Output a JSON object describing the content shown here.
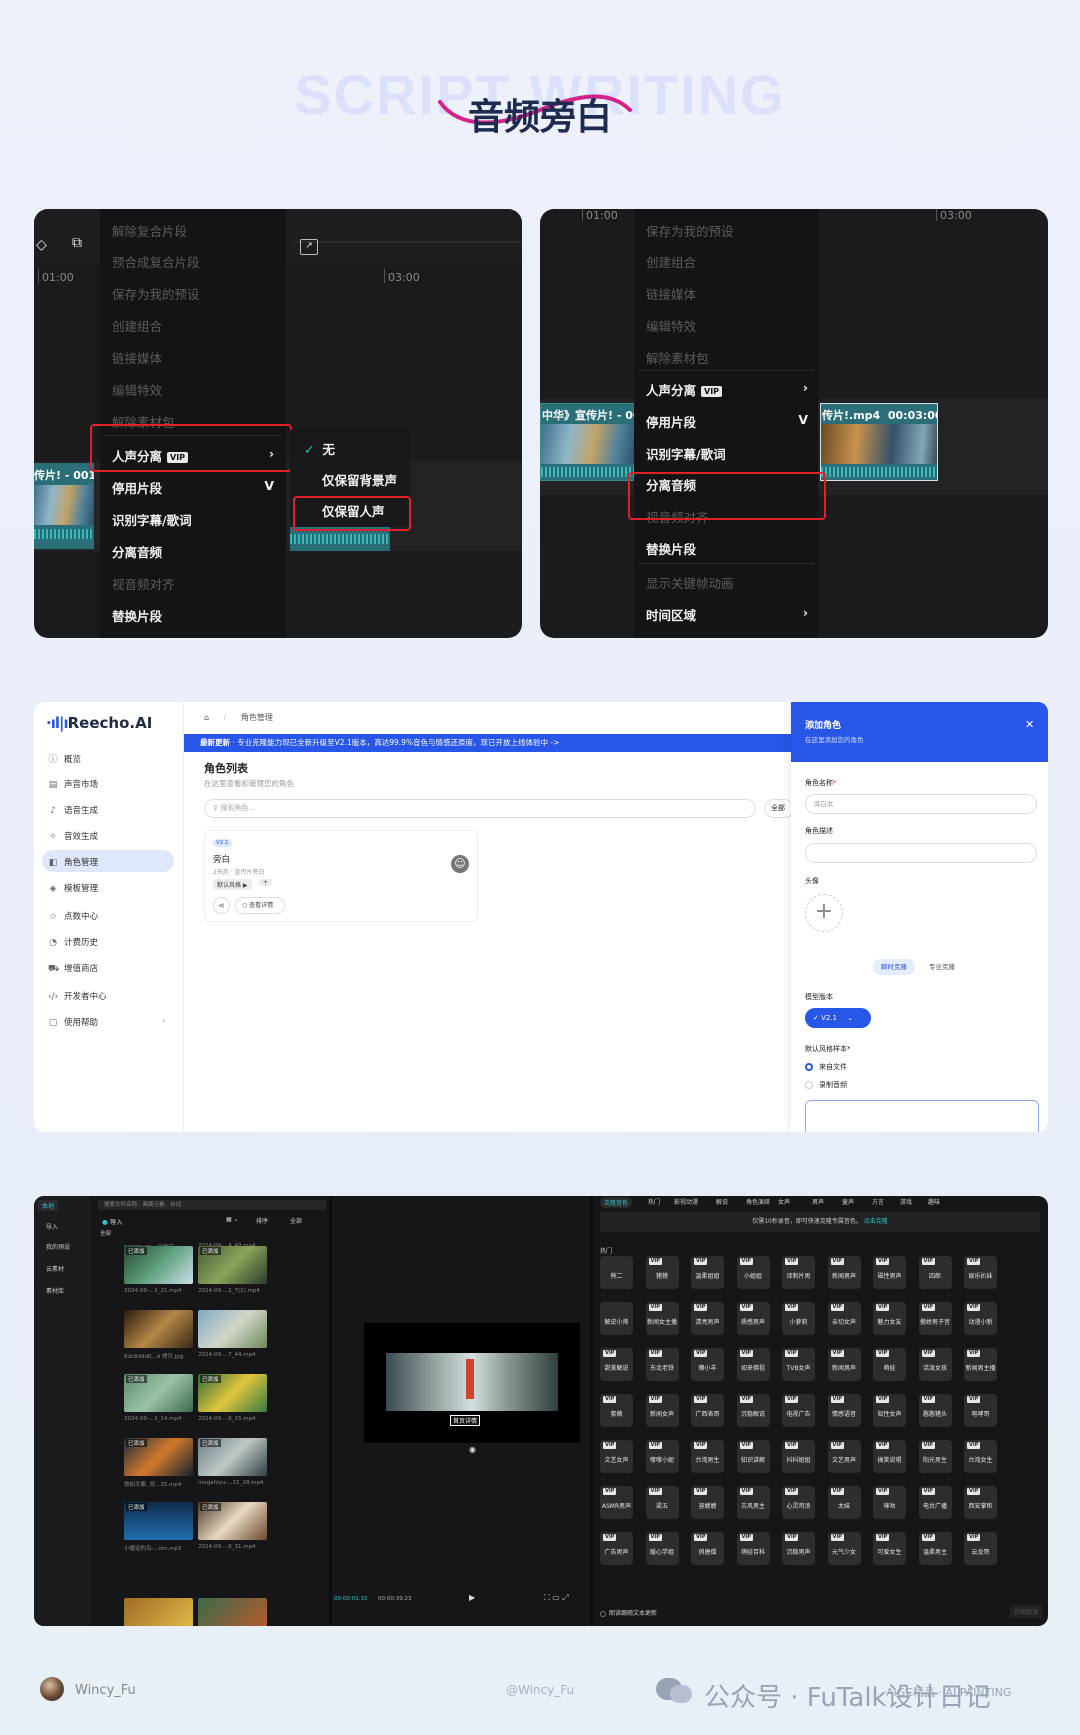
{
  "header": {
    "bg_word": "SCRIPT WRITING",
    "title": "音频旁白"
  },
  "panel1": {
    "timecode_left": "01:00",
    "timecode_right": "03:00",
    "context_menu": [
      {
        "label": "解除复合片段",
        "disabled": true
      },
      {
        "label": "预合成复合片段",
        "disabled": true
      },
      {
        "label": "保存为我的预设",
        "disabled": true
      },
      {
        "label": "创建组合",
        "disabled": true
      },
      {
        "label": "链接媒体",
        "disabled": true
      },
      {
        "label": "编辑特效",
        "disabled": true
      },
      {
        "label": "解除素材包",
        "disabled": true
      },
      {
        "label": "人声分离",
        "vip": "VIP",
        "arrow": "›"
      },
      {
        "label": "停用片段",
        "arrow": "V"
      },
      {
        "label": "识别字幕/歌词"
      },
      {
        "label": "分离音频"
      },
      {
        "label": "视音频对齐",
        "disabled": true
      },
      {
        "label": "替换片段"
      }
    ],
    "submenu": [
      {
        "label": "无",
        "check": "✓"
      },
      {
        "label": "仅保留背景声"
      },
      {
        "label": "仅保留人声"
      }
    ],
    "clip_label": "传片! - 001"
  },
  "panel2": {
    "timecode_left": "01:00",
    "timecode_right": "03:00",
    "context_menu": [
      {
        "label": "保存为我的预设",
        "disabled": true
      },
      {
        "label": "创建组合",
        "disabled": true
      },
      {
        "label": "链接媒体",
        "disabled": true
      },
      {
        "label": "编辑特效",
        "disabled": true
      },
      {
        "label": "解除素材包",
        "disabled": true
      },
      {
        "label": "人声分离",
        "vip": "VIP",
        "arrow": "›"
      },
      {
        "label": "停用片段",
        "arrow": "V"
      },
      {
        "label": "识别字幕/歌词"
      },
      {
        "label": "分离音频"
      },
      {
        "label": "视音频对齐",
        "disabled": true
      },
      {
        "label": "替换片段"
      },
      {
        "label": "显示关键帧动画",
        "disabled": true
      },
      {
        "label": "时间区域",
        "arrow": "›"
      }
    ],
    "clip_left_label": "中华》宣传片! - 00",
    "clip_right_label": "传片!.mp4",
    "clip_right_time": "00:03:00:0"
  },
  "web": {
    "logo": "Reecho.AI",
    "sidebar": [
      "概览",
      "声音市场",
      "语音生成",
      "音效生成",
      "角色管理",
      "模板管理",
      "点数中心",
      "计费历史",
      "增值商店",
      "开发者中心",
      "使用帮助"
    ],
    "sidebar_active": 4,
    "breadcrumb_sep": "/",
    "breadcrumb": "角色管理",
    "banner_strong": "最新更新",
    "banner_text": " · 专业克隆能力现已全新升级至V2.1版本，高达99.9%音色与情感还原度，现已开放上线体验中 ->",
    "list_title": "角色列表",
    "list_subtitle": "在这里查看和管理您的角色",
    "search_placeholder": "搜索角色...",
    "filter_all": "全部",
    "card": {
      "badge": "V2.1",
      "name": "旁白",
      "meta": "2天前 · 宣传片旁白",
      "chip": "默认风格 ▶",
      "chip2": "+",
      "detail": "查看详情"
    },
    "drawer": {
      "title": "添加角色",
      "subtitle": "在这里添加您的角色",
      "close": "✕",
      "name_label": "角色名称",
      "required": "*",
      "name_value": "旁白女",
      "desc_label": "角色描述",
      "avatar_label": "头像",
      "tab_instant": "瞬时克隆",
      "tab_pro": "专业克隆",
      "model_label": "模型版本",
      "model_value": "V2.1",
      "style_label": "默认风格样本",
      "option_file": "来自文件",
      "option_record": "录制音频"
    }
  },
  "bottom": {
    "left_nav": [
      "本地",
      "导入",
      "我的预设",
      "云素材",
      "素材库"
    ],
    "search_placeholder": "搜索文件名称、画面元素、台词",
    "import_label": "导入",
    "toolbar": [
      "排序",
      "全部"
    ],
    "group_label": "全部",
    "media": [
      {
        "tag": "",
        "cap": "92332e71...开眼床.jpeg"
      },
      {
        "tag": "",
        "cap": "2024-09-...4_49.mp4"
      },
      {
        "tag": "已添加",
        "cap": "2024-09-...1_21.mp4"
      },
      {
        "tag": "已添加",
        "cap": "2024-09-...2_7(1).mp4"
      },
      {
        "tag": "",
        "cap": "8dc8ddd0...d 拷贝.jpg"
      },
      {
        "tag": "",
        "cap": "2024-09-...7_44.mp4"
      },
      {
        "tag": "已添加",
        "cap": "2024-09-...1_14.mp4"
      },
      {
        "tag": "已添加",
        "cap": "2024-09-...6_15.mp4"
      },
      {
        "tag": "已添加",
        "cap": "旅拍文案, 领...35.mp4"
      },
      {
        "tag": "已添加",
        "cap": "megahiyu-...15_28.mp4"
      },
      {
        "tag": "已添加",
        "cap": "小媛运的鸟-...om.mp3"
      },
      {
        "tag": "已添加",
        "cap": "2024-09-...6_31.mp4"
      }
    ],
    "player_time": "00:00:01:15",
    "player_total": "00:00:39:23",
    "subtitle_text": "首页详情",
    "voice_tabs": [
      "克隆音色",
      "热门",
      "影视动漫",
      "解说",
      "角色演绎",
      "女声",
      "男声",
      "童声",
      "方言",
      "游戏",
      "趣味"
    ],
    "voice_notice": "仅需10秒录音，即可快速克隆专属音色。",
    "voice_notice_link": "点击克隆",
    "hot_label": "热门",
    "voices": [
      "熊二",
      "猪猪",
      "温柔姐姐",
      "小姐姐",
      "译制片男",
      "新闻男声",
      "磁性男声",
      "四郎",
      "娱乐扒妹",
      "解说小帅",
      "新闻女主播",
      "清亮男声",
      "质感男声",
      "小萝莉",
      "亲切女声",
      "魅力女友",
      "傲娇男子音",
      "动漫小新",
      "甜美解说",
      "东北老铁",
      "懒小羊",
      "如来佛祖",
      "TVB女声",
      "新闻男声",
      "萌娃",
      "活泼女孩",
      "新闻男主播",
      "紫薇",
      "新闻女声",
      "广西表哥",
      "沉稳解说",
      "电视广告",
      "情感语音",
      "知性女声",
      "憨憨猪头",
      "咆哮哥",
      "文艺女声",
      "嗲嗲小妮",
      "台湾男生",
      "知识讲解",
      "抖抖姐姐",
      "文艺男声",
      "搞笑说唱",
      "阳光男生",
      "台湾女生",
      "ASMR男声",
      "梁五",
      "容嬷嬷",
      "古风男主",
      "心灵鸡汤",
      "太妹",
      "咪咕",
      "电台广播",
      "西安掌柜",
      "广告男声",
      "暖心学姐",
      "俏唐僧",
      "萌娃百科",
      "沉稳男声",
      "元气少女",
      "可爱女生",
      "温柔男主",
      "云龙哥"
    ],
    "bottom_check": "朗读跟随文本更新",
    "bottom_btn": "开始朗读"
  },
  "footer": {
    "author": "Wincy_Fu",
    "handle": "@Wincy_Fu",
    "brand": "公众号 · FuTalk设计日记",
    "brand_overlay": "AIGC精品 · AI PAINTING"
  }
}
